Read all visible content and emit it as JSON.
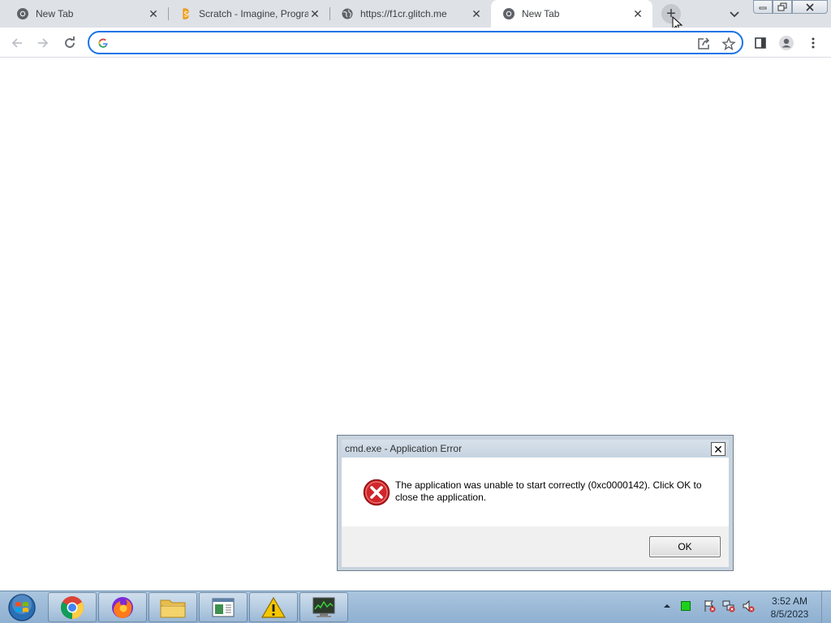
{
  "browser": {
    "tabs": [
      {
        "title": "New Tab",
        "icon": "chrome-icon",
        "active": false
      },
      {
        "title": "Scratch - Imagine, Progra",
        "icon": "scratch-icon",
        "active": false
      },
      {
        "title": "https://f1cr.glitch.me",
        "icon": "globe-icon",
        "active": false
      },
      {
        "title": "New Tab",
        "icon": "chrome-icon",
        "active": true
      }
    ],
    "new_tab_symbol": "+",
    "tab_close_symbol": "✕",
    "omnibox": {
      "value": "",
      "placeholder": ""
    }
  },
  "dialog": {
    "title": "cmd.exe - Application Error",
    "close_symbol": "✕",
    "message": "The application was unable to start correctly (0xc0000142). Click OK to close the application.",
    "ok_label": "OK",
    "icon": "error-icon"
  },
  "taskbar": {
    "apps": [
      {
        "name": "chrome",
        "icon": "chrome-icon"
      },
      {
        "name": "firefox",
        "icon": "firefox-icon"
      },
      {
        "name": "file-explorer",
        "icon": "folder-icon"
      },
      {
        "name": "document-viewer",
        "icon": "document-icon"
      },
      {
        "name": "warning-app",
        "icon": "warning-icon"
      },
      {
        "name": "task-manager",
        "icon": "monitor-icon"
      }
    ],
    "clock": {
      "time": "3:52 AM",
      "date": "8/5/2023"
    }
  },
  "colors": {
    "accent": "#1a73e8",
    "tabstrip": "#dee1e6",
    "error_red": "#d0262a",
    "taskbar": "#9bbad8"
  }
}
